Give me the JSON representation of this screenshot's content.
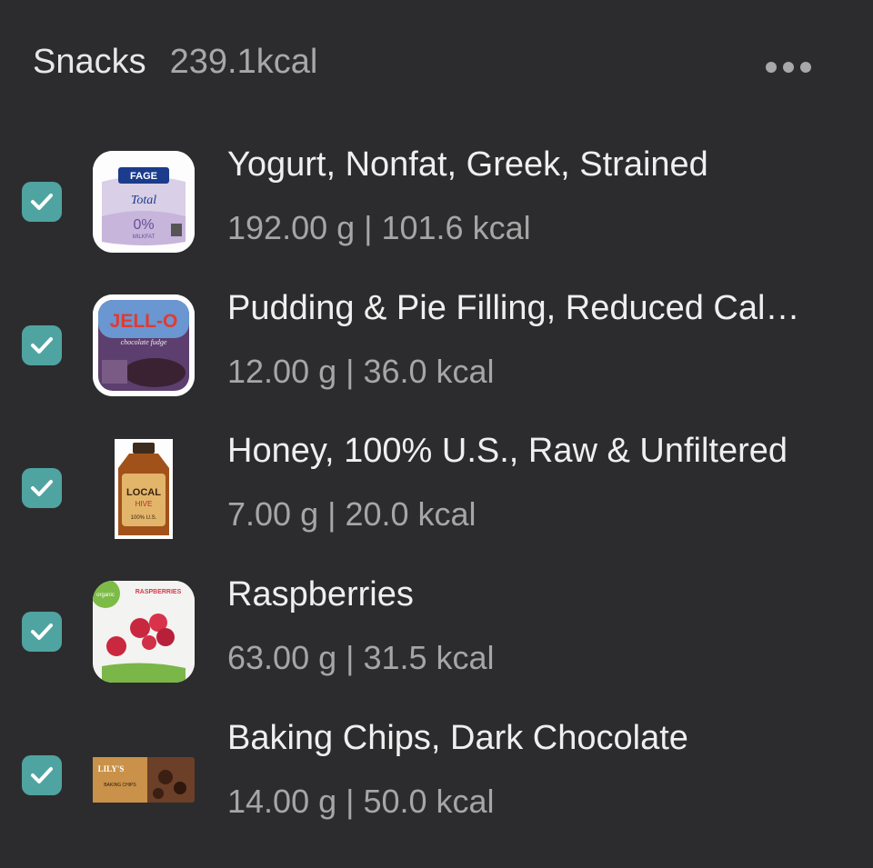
{
  "meal": {
    "title": "Snacks",
    "total": "239.1kcal"
  },
  "colors": {
    "background": "#2c2c2e",
    "check_accent": "#4fa4a1",
    "primary_text": "#efefef",
    "secondary_text": "#a6a6a6"
  },
  "items": [
    {
      "name": "Yogurt, Nonfat, Greek, Strained",
      "detail": "192.00 g | 101.6 kcal",
      "checked": true,
      "image": "yogurt-container-image",
      "brand": "FAGE",
      "sub": "Total",
      "badge": "0%",
      "badge_sub": "MILKFAT"
    },
    {
      "name": "Pudding & Pie Filling, Reduced Cal…",
      "detail": "12.00 g | 36.0 kcal",
      "checked": true,
      "image": "pudding-box-image",
      "brand": "JELL-O",
      "sub": "chocolate fudge"
    },
    {
      "name": "Honey, 100% U.S., Raw & Unfiltered",
      "detail": "7.00 g | 20.0 kcal",
      "checked": true,
      "image": "honey-bottle-image",
      "brand": "LOCAL",
      "sub": "HIVE",
      "badge": "100% U.S."
    },
    {
      "name": "Raspberries",
      "detail": "63.00 g | 31.5 kcal",
      "checked": true,
      "image": "raspberries-bag-image",
      "brand": "RASPBERRIES",
      "sub": "organic"
    },
    {
      "name": "Baking Chips, Dark Chocolate",
      "detail": "14.00 g | 50.0 kcal",
      "checked": true,
      "image": "chocolate-chips-bag-image",
      "brand": "LILY'S",
      "sub": "BAKING CHIPS"
    }
  ]
}
